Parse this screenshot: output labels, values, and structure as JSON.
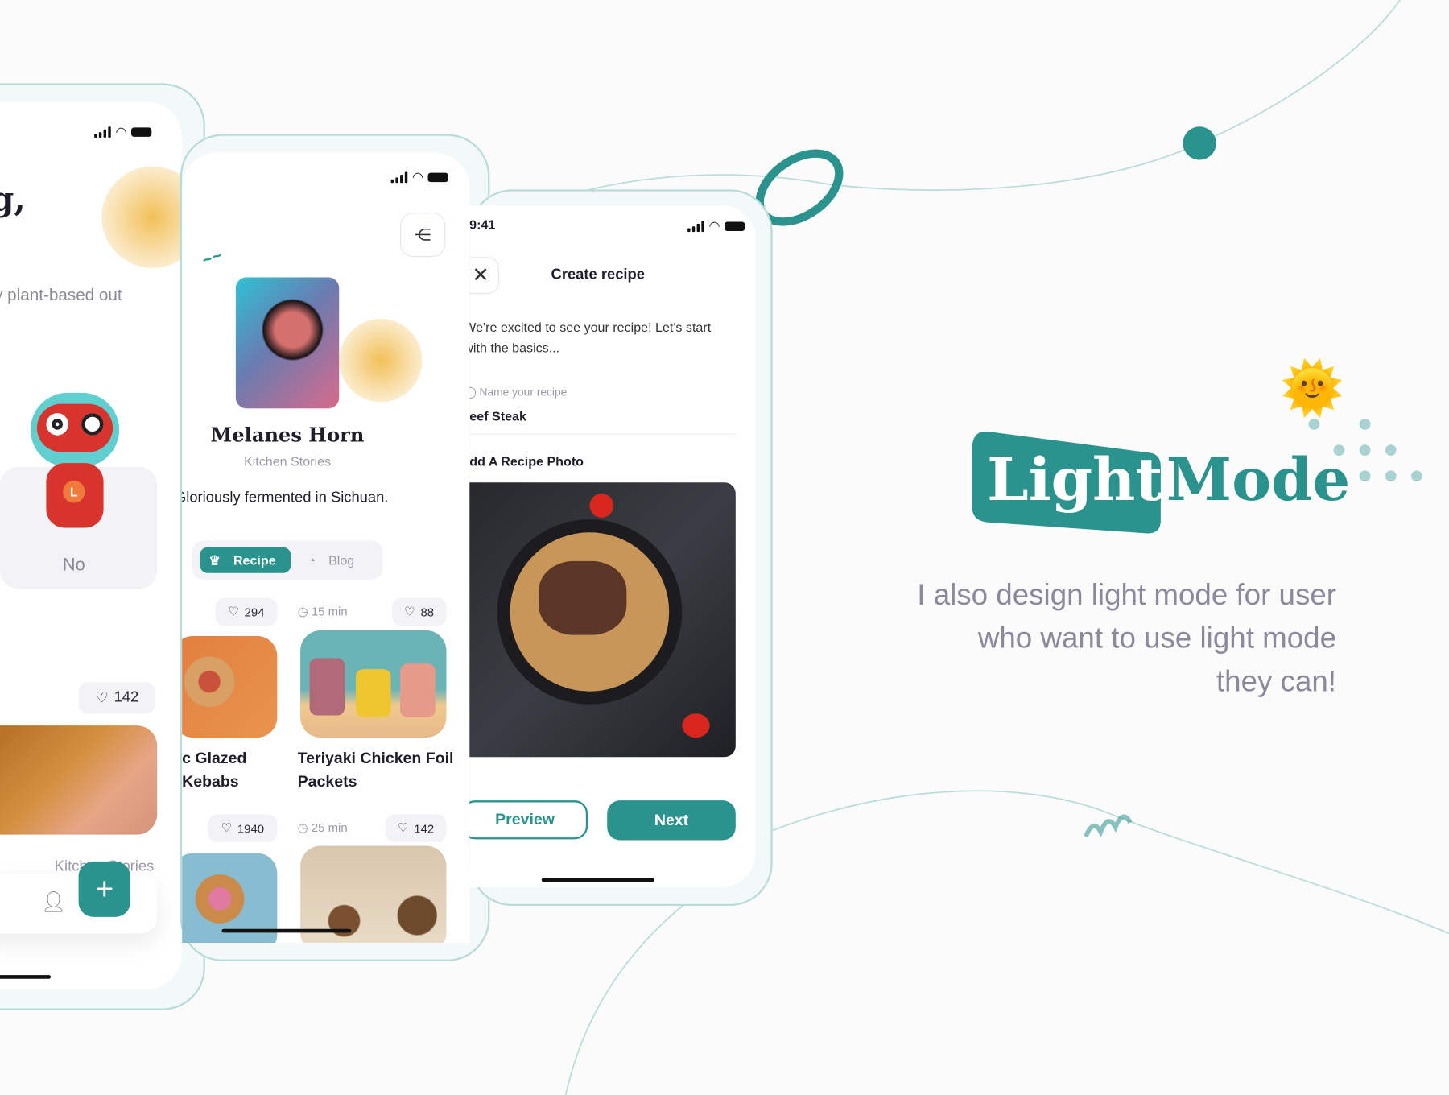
{
  "colors": {
    "accent": "#2a938e",
    "accent_light": "#a9d3d0",
    "text": "#1e1e2a",
    "muted": "#9a9aa8",
    "blob": "#f2c058"
  },
  "phone_onboarding": {
    "heading_fragment": "g,",
    "question_line1": "ly plant-based out",
    "question_line2": "?",
    "answer_option": "No",
    "likes": "142",
    "source": "Kitchen Stories",
    "icons": [
      "signal-icon",
      "wifi-icon",
      "battery-icon",
      "heart-icon",
      "user-icon",
      "plus-icon"
    ]
  },
  "phone_profile": {
    "name": "Melanes Horn",
    "subtitle": "Kitchen Stories",
    "bio": "Gloriously fermented in Sichuan.",
    "tabs": [
      {
        "label": "Recipe",
        "active": true,
        "icon": "chef-hat-icon"
      },
      {
        "label": "Blog",
        "active": false,
        "icon": "note-icon"
      }
    ],
    "recipes_row1": {
      "left_likes": "294",
      "time": "15 min",
      "right_likes": "88",
      "left_title_line1": "c Glazed",
      "left_title_line2": "Kebabs",
      "right_title_line1": "Teriyaki Chicken Foil",
      "right_title_line2": "Packets"
    },
    "recipes_row2": {
      "left_likes": "1940",
      "time": "25 min",
      "right_likes": "142"
    }
  },
  "phone_create": {
    "time": "9:41",
    "title": "Create recipe",
    "intro_line1": "We're excited to see your recipe! Let's start",
    "intro_line2": "with the basics...",
    "field_label": "Name your recipe",
    "field_value": "Beef Steak",
    "photo_label": "Add A Recipe Photo",
    "preview_button": "Preview",
    "next_button": "Next"
  },
  "hero": {
    "badge_word": "Light",
    "word2": "Mode",
    "line1": "I also design light mode for user",
    "line2": "who want to use light mode",
    "line3": "they can!",
    "emoji": "🌞"
  }
}
